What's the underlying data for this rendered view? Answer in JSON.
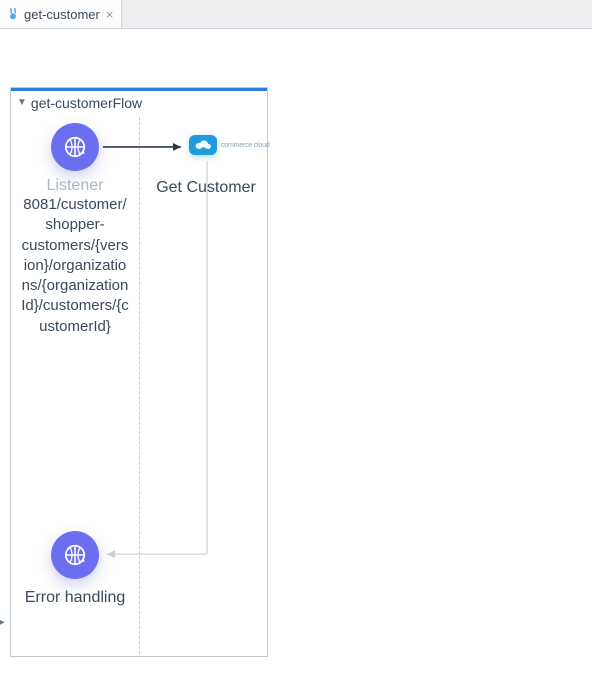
{
  "tab": {
    "label": "get-customer",
    "icon": "mule-rabbit-icon"
  },
  "flow": {
    "title": "get-customerFlow",
    "source": {
      "name": "Listener",
      "path": "8081/customer/shopper-customers/{version}/organizations/{organizationId}/customers/{customerId}"
    },
    "process": {
      "name": "Get Customer",
      "connector_badge_text": "commerce cloud"
    },
    "error_section": {
      "title": "Error handling"
    }
  }
}
